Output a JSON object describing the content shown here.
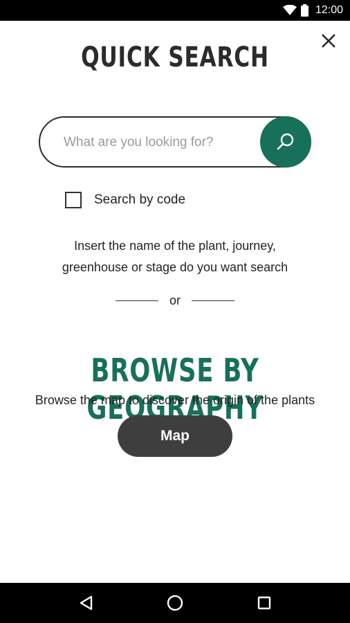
{
  "status_bar": {
    "time": "12:00",
    "icons": [
      "wifi-icon",
      "battery-icon"
    ]
  },
  "header": {
    "title": "QUICK SEARCH",
    "close_icon": "close-icon"
  },
  "search": {
    "placeholder": "What are you looking for?",
    "value": "",
    "button_icon": "search-icon"
  },
  "search_by_code": {
    "label": "Search by code",
    "checked": false
  },
  "hint": {
    "line1": "Insert the name of the plant, journey,",
    "line2": "greenhouse or stage do you want search"
  },
  "divider": {
    "text": "or"
  },
  "geography": {
    "title": "BROWSE BY GEOGRAPHY",
    "subtitle": "Browse the map to discover the origin of the plants",
    "button_label": "Map"
  },
  "nav_bar": {
    "icons": [
      "back-icon",
      "home-icon",
      "recents-icon"
    ]
  },
  "colors": {
    "accent": "#17705a",
    "button_dark": "#3e3e3e",
    "text": "#222222"
  }
}
